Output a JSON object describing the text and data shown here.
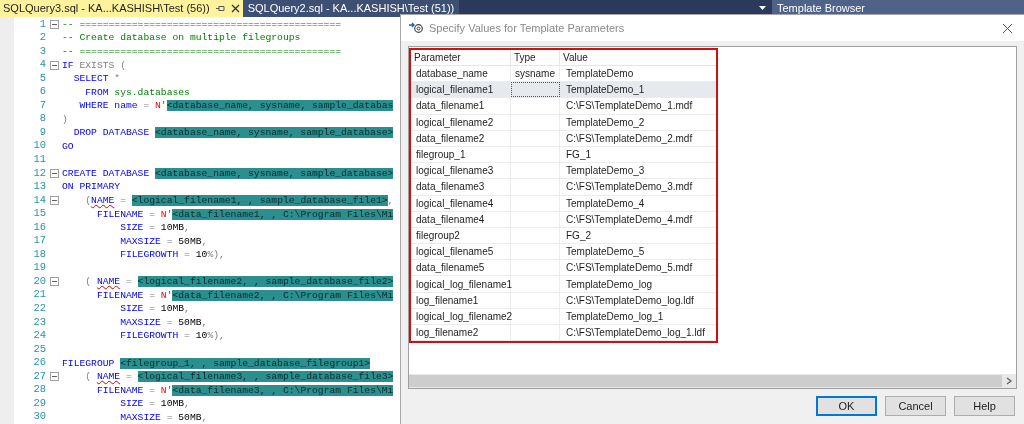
{
  "tabs": [
    {
      "label": "SQLQuery3.sql - KA...KASHISH\\Test (56))",
      "selected": true
    },
    {
      "label": "SQLQuery2.sql - KA...KASHISH\\Test (51))",
      "selected": false
    }
  ],
  "side_panel": {
    "title": "Template Browser"
  },
  "editor": {
    "lines": [
      {
        "number": "1",
        "fold": true,
        "tokens": [
          {
            "kind": "comment",
            "text": "-- ============================================="
          }
        ]
      },
      {
        "number": "2",
        "fold": false,
        "tokens": [
          {
            "kind": "comment",
            "text": "-- Create database on multiple filegroups"
          }
        ]
      },
      {
        "number": "3",
        "fold": false,
        "tokens": [
          {
            "kind": "comment",
            "text": "-- ============================================="
          }
        ]
      },
      {
        "number": "4",
        "fold": true,
        "tokens": [
          {
            "kind": "keyword",
            "text": "IF"
          },
          {
            "kind": "operator",
            "text": " EXISTS ("
          }
        ]
      },
      {
        "number": "5",
        "fold": false,
        "tokens": [
          {
            "kind": "keyword",
            "text": "  SELECT"
          },
          {
            "kind": "operator",
            "text": " *"
          }
        ]
      },
      {
        "number": "6",
        "fold": false,
        "tokens": [
          {
            "kind": "keyword",
            "text": "    FROM"
          },
          {
            "kind": "object",
            "text": " sys.databases"
          }
        ]
      },
      {
        "number": "7",
        "fold": false,
        "tokens": [
          {
            "kind": "keyword",
            "text": "   WHERE name"
          },
          {
            "kind": "operator",
            "text": " = "
          },
          {
            "kind": "string",
            "text": "N'"
          },
          {
            "kind": "param",
            "text": "<database_name, sysname, sample_databas"
          }
        ]
      },
      {
        "number": "8",
        "fold": false,
        "tokens": [
          {
            "kind": "operator",
            "text": ")"
          }
        ]
      },
      {
        "number": "9",
        "fold": false,
        "tokens": [
          {
            "kind": "keyword",
            "text": "  DROP DATABASE "
          },
          {
            "kind": "param",
            "text": "<database_name, sysname, sample_database>"
          }
        ]
      },
      {
        "number": "10",
        "fold": false,
        "tokens": [
          {
            "kind": "keyword",
            "text": "GO"
          }
        ]
      },
      {
        "number": "11",
        "fold": false
      },
      {
        "number": "12",
        "fold": true,
        "tokens": [
          {
            "kind": "keyword",
            "text": "CREATE DATABASE "
          },
          {
            "kind": "param",
            "text": "<database_name, sysname, sample_database>"
          }
        ]
      },
      {
        "number": "13",
        "fold": false,
        "tokens": [
          {
            "kind": "keyword",
            "text": "ON PRIMARY"
          }
        ]
      },
      {
        "number": "14",
        "fold": true,
        "tokens": [
          {
            "kind": "operator",
            "text": "    ("
          },
          {
            "kind": "error",
            "text": "NAME"
          },
          {
            "kind": "operator",
            "text": " = "
          },
          {
            "kind": "param",
            "text": "<logical_filename1, , sample_database_file1>"
          },
          {
            "kind": "operator",
            "text": ","
          }
        ]
      },
      {
        "number": "15",
        "fold": false,
        "tokens": [
          {
            "kind": "keyword",
            "text": "      FILENAME"
          },
          {
            "kind": "operator",
            "text": " = "
          },
          {
            "kind": "string",
            "text": "N'"
          },
          {
            "kind": "param",
            "text": "<data_filename1, , C:\\Program Files\\Mi"
          }
        ]
      },
      {
        "number": "16",
        "fold": false,
        "tokens": [
          {
            "kind": "keyword",
            "text": "          SIZE"
          },
          {
            "kind": "operator",
            "text": " = "
          },
          {
            "kind": "plain",
            "text": "10MB"
          },
          {
            "kind": "operator",
            "text": ","
          }
        ]
      },
      {
        "number": "17",
        "fold": false,
        "tokens": [
          {
            "kind": "keyword",
            "text": "          MAXSIZE"
          },
          {
            "kind": "operator",
            "text": " = "
          },
          {
            "kind": "plain",
            "text": "50MB"
          },
          {
            "kind": "operator",
            "text": ","
          }
        ]
      },
      {
        "number": "18",
        "fold": false,
        "tokens": [
          {
            "kind": "keyword",
            "text": "          FILEGROWTH"
          },
          {
            "kind": "operator",
            "text": " = "
          },
          {
            "kind": "plain",
            "text": "10"
          },
          {
            "kind": "operator",
            "text": "%),"
          }
        ]
      },
      {
        "number": "19",
        "fold": false
      },
      {
        "number": "20",
        "fold": true,
        "tokens": [
          {
            "kind": "operator",
            "text": "    ( "
          },
          {
            "kind": "error",
            "text": "NAME"
          },
          {
            "kind": "operator",
            "text": " = "
          },
          {
            "kind": "param",
            "text": "<logical_filename2, , sample_database_file2>"
          }
        ]
      },
      {
        "number": "21",
        "fold": false,
        "tokens": [
          {
            "kind": "keyword",
            "text": "      FILENAME"
          },
          {
            "kind": "operator",
            "text": " = "
          },
          {
            "kind": "string",
            "text": "N'"
          },
          {
            "kind": "param",
            "text": "<data_filename2, , C:\\Program Files\\Mi"
          }
        ]
      },
      {
        "number": "22",
        "fold": false,
        "tokens": [
          {
            "kind": "keyword",
            "text": "          SIZE"
          },
          {
            "kind": "operator",
            "text": " = "
          },
          {
            "kind": "plain",
            "text": "10MB"
          },
          {
            "kind": "operator",
            "text": ","
          }
        ]
      },
      {
        "number": "23",
        "fold": false,
        "tokens": [
          {
            "kind": "keyword",
            "text": "          MAXSIZE"
          },
          {
            "kind": "operator",
            "text": " = "
          },
          {
            "kind": "plain",
            "text": "50MB"
          },
          {
            "kind": "operator",
            "text": ","
          }
        ]
      },
      {
        "number": "24",
        "fold": false,
        "tokens": [
          {
            "kind": "keyword",
            "text": "          FILEGROWTH"
          },
          {
            "kind": "operator",
            "text": " = "
          },
          {
            "kind": "plain",
            "text": "10"
          },
          {
            "kind": "operator",
            "text": "%),"
          }
        ]
      },
      {
        "number": "25",
        "fold": false
      },
      {
        "number": "26",
        "fold": false,
        "tokens": [
          {
            "kind": "keyword",
            "text": "FILEGROUP "
          },
          {
            "kind": "param",
            "text": "<filegroup_1, , sample_database_filegroup1>"
          }
        ]
      },
      {
        "number": "27",
        "fold": true,
        "tokens": [
          {
            "kind": "operator",
            "text": "    ( "
          },
          {
            "kind": "error",
            "text": "NAME"
          },
          {
            "kind": "operator",
            "text": " = "
          },
          {
            "kind": "param",
            "text": "<logical_filename3, , sample_database_file3>"
          }
        ]
      },
      {
        "number": "28",
        "fold": false,
        "tokens": [
          {
            "kind": "keyword",
            "text": "      FILENAME"
          },
          {
            "kind": "operator",
            "text": " = "
          },
          {
            "kind": "string",
            "text": "N'"
          },
          {
            "kind": "param",
            "text": "<data_filename3, , C:\\Program Files\\Mi"
          }
        ]
      },
      {
        "number": "29",
        "fold": false,
        "tokens": [
          {
            "kind": "keyword",
            "text": "          SIZE"
          },
          {
            "kind": "operator",
            "text": " = "
          },
          {
            "kind": "plain",
            "text": "10MB"
          },
          {
            "kind": "operator",
            "text": ","
          }
        ]
      },
      {
        "number": "30",
        "fold": false,
        "tokens": [
          {
            "kind": "keyword",
            "text": "          MAXSIZE"
          },
          {
            "kind": "operator",
            "text": " = "
          },
          {
            "kind": "plain",
            "text": "50MB"
          },
          {
            "kind": "operator",
            "text": ","
          }
        ]
      }
    ]
  },
  "dialog": {
    "title": "Specify Values for Template Parameters",
    "table": {
      "columns": [
        "Parameter",
        "Type",
        "Value"
      ],
      "rows": [
        {
          "parameter": "database_name",
          "type": "sysname",
          "value": "TemplateDemo",
          "selected": false
        },
        {
          "parameter": "logical_filename1",
          "value": "TemplateDemo_1",
          "selected": true
        },
        {
          "parameter": "data_filename1",
          "value": "C:\\FS\\TemplateDemo_1.mdf",
          "selected": false
        },
        {
          "parameter": "logical_filename2",
          "value": "TemplateDemo_2",
          "selected": false
        },
        {
          "parameter": "data_filename2",
          "value": "C:\\FS\\TemplateDemo_2.mdf",
          "selected": false
        },
        {
          "parameter": "filegroup_1",
          "value": "FG_1",
          "selected": false
        },
        {
          "parameter": "logical_filename3",
          "value": "TemplateDemo_3",
          "selected": false
        },
        {
          "parameter": "data_filename3",
          "value": "C:\\FS\\TemplateDemo_3.mdf",
          "selected": false
        },
        {
          "parameter": "logical_filename4",
          "value": "TemplateDemo_4",
          "selected": false
        },
        {
          "parameter": "data_filename4",
          "value": "C:\\FS\\TemplateDemo_4.mdf",
          "selected": false
        },
        {
          "parameter": "filegroup2",
          "value": "FG_2",
          "selected": false
        },
        {
          "parameter": "logical_filename5",
          "value": "TemplateDemo_5",
          "selected": false
        },
        {
          "parameter": "data_filename5",
          "value": "C:\\FS\\TemplateDemo_5.mdf",
          "selected": false
        },
        {
          "parameter": "logical_log_filename1",
          "value": "TemplateDemo_log",
          "selected": false
        },
        {
          "parameter": "log_filename1",
          "value": "C:\\FS\\TemplateDemo_log.ldf",
          "selected": false
        },
        {
          "parameter": "logical_log_filename2",
          "value": "TemplateDemo_log_1",
          "selected": false
        },
        {
          "parameter": "log_filename2",
          "value": "C:\\FS\\TemplateDemo_log_1.ldf",
          "selected": false
        }
      ]
    },
    "buttons": [
      {
        "label": "OK",
        "selected": true
      },
      {
        "label": "Cancel",
        "selected": false
      },
      {
        "label": "Help",
        "selected": false
      }
    ]
  }
}
